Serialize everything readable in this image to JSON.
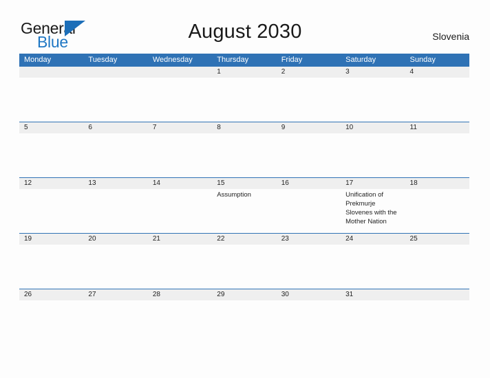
{
  "brand": {
    "name_part1": "General",
    "name_part2": "Blue",
    "flag_icon": "triangle-flag-icon"
  },
  "header": {
    "title": "August 2030",
    "region": "Slovenia"
  },
  "colors": {
    "header_blue": "#2f72b5",
    "logo_blue": "#1f77c4",
    "date_strip_gray": "#efefef",
    "page_background": "#fdfdfd",
    "text": "#222222"
  },
  "calendar": {
    "month": "August",
    "year": "2030",
    "weekday_headers": [
      "Monday",
      "Tuesday",
      "Wednesday",
      "Thursday",
      "Friday",
      "Saturday",
      "Sunday"
    ],
    "weeks": [
      {
        "days": [
          {
            "date": "",
            "event": ""
          },
          {
            "date": "",
            "event": ""
          },
          {
            "date": "",
            "event": ""
          },
          {
            "date": "1",
            "event": ""
          },
          {
            "date": "2",
            "event": ""
          },
          {
            "date": "3",
            "event": ""
          },
          {
            "date": "4",
            "event": ""
          }
        ]
      },
      {
        "days": [
          {
            "date": "5",
            "event": ""
          },
          {
            "date": "6",
            "event": ""
          },
          {
            "date": "7",
            "event": ""
          },
          {
            "date": "8",
            "event": ""
          },
          {
            "date": "9",
            "event": ""
          },
          {
            "date": "10",
            "event": ""
          },
          {
            "date": "11",
            "event": ""
          }
        ]
      },
      {
        "days": [
          {
            "date": "12",
            "event": ""
          },
          {
            "date": "13",
            "event": ""
          },
          {
            "date": "14",
            "event": ""
          },
          {
            "date": "15",
            "event": "Assumption"
          },
          {
            "date": "16",
            "event": ""
          },
          {
            "date": "17",
            "event": "Unification of Prekmurje Slovenes with the Mother Nation"
          },
          {
            "date": "18",
            "event": ""
          }
        ]
      },
      {
        "days": [
          {
            "date": "19",
            "event": ""
          },
          {
            "date": "20",
            "event": ""
          },
          {
            "date": "21",
            "event": ""
          },
          {
            "date": "22",
            "event": ""
          },
          {
            "date": "23",
            "event": ""
          },
          {
            "date": "24",
            "event": ""
          },
          {
            "date": "25",
            "event": ""
          }
        ]
      },
      {
        "days": [
          {
            "date": "26",
            "event": ""
          },
          {
            "date": "27",
            "event": ""
          },
          {
            "date": "28",
            "event": ""
          },
          {
            "date": "29",
            "event": ""
          },
          {
            "date": "30",
            "event": ""
          },
          {
            "date": "31",
            "event": ""
          },
          {
            "date": "",
            "event": ""
          }
        ]
      }
    ]
  }
}
